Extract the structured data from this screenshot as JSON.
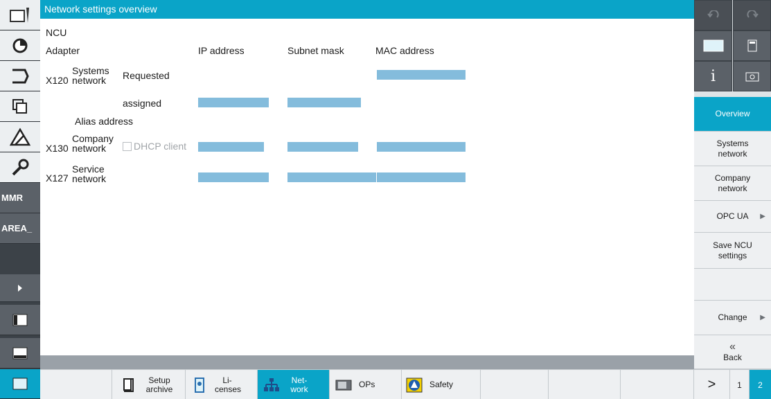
{
  "window": {
    "title": "Network settings overview"
  },
  "left_bar": {
    "items": [
      {
        "icon": "machine-tool-icon"
      },
      {
        "icon": "parameter-icon"
      },
      {
        "icon": "program-icon"
      },
      {
        "icon": "program-manager-icon"
      },
      {
        "icon": "diagnostics-icon"
      },
      {
        "icon": "setup-wrench-icon"
      },
      {
        "label": "MMR"
      },
      {
        "label": "AREA_"
      },
      {
        "icon": "expand-arrow-icon"
      },
      {
        "icon": "window-icon"
      },
      {
        "icon": "window-icon"
      },
      {
        "icon": "window-icon"
      }
    ]
  },
  "main": {
    "ncu_label": "NCU",
    "headers": {
      "adapter": "Adapter",
      "ip": "IP address",
      "subnet": "Subnet mask",
      "mac": "MAC address"
    },
    "x120": {
      "port": "X120",
      "name": "Systems network",
      "requested": "Requested",
      "assigned": "assigned"
    },
    "alias": "Alias address",
    "x130": {
      "port": "X130",
      "name": "Company network",
      "dhcp": "DHCP client"
    },
    "x127": {
      "port": "X127",
      "name": "Service network"
    }
  },
  "right_bar": {
    "overview": "Overview",
    "systems_network": "Systems network",
    "company_network": "Company network",
    "opc_ua": "OPC UA",
    "save_ncu": "Save NCU settings",
    "change": "Change",
    "back": "Back"
  },
  "bottom_bar": {
    "setup_archive": "Setup archive",
    "licenses": "Li- censes",
    "network": "Net- work",
    "ops": "OPs",
    "safety": "Safety",
    "etc": ">",
    "page1": "1",
    "page2": "2"
  },
  "colors": {
    "accent": "#0aa4c8",
    "masked_value": "#6fb0d6"
  }
}
